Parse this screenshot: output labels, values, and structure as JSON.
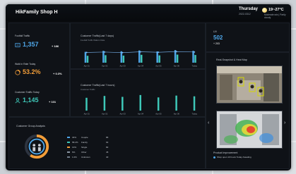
{
  "header": {
    "title": "HikFamily Shop H",
    "day": "Thursday",
    "date": "2022-0312",
    "temperature": "19~27°C",
    "weather": "Moderate rain | Partly cloudy"
  },
  "kpis": [
    {
      "label": "Footfall Traffic",
      "value": "1,357",
      "delta": "+ 186",
      "color": "#4ea6e8"
    },
    {
      "label": "Walk In Rate Today",
      "value": "53.2%",
      "delta": "+ 0.3%",
      "color": "#f29d38"
    },
    {
      "label": "Customer Traffic Today",
      "value": "1,145",
      "delta": "+ 101",
      "color": "#3ec7b8"
    }
  ],
  "traffic7days": {
    "title": "Customer Traffic(Last 7 days)",
    "legend": "Footfall Traffic  Walk-In Rate",
    "chart_data": {
      "type": "bar",
      "categories": [
        "Apr 01",
        "Apr 02",
        "Apr 03",
        "Apr 04",
        "Apr 05",
        "Apr 06",
        "Today"
      ],
      "series": [
        {
          "name": "Footfall Traffic",
          "values": [
            55,
            60,
            58,
            62,
            57,
            64,
            60
          ]
        },
        {
          "name": "Walk-In Rate",
          "values": [
            35,
            38,
            36,
            40,
            37,
            41,
            39
          ]
        }
      ],
      "line": [
        52,
        54,
        51,
        55,
        53,
        56,
        54
      ],
      "ylim": [
        0,
        100
      ],
      "colors": [
        "#4ea6e8",
        "#3ec7b8"
      ]
    }
  },
  "traffic7hours": {
    "title": "Customer Traffic(Last 7 hours)",
    "legend": "Customer Traffic",
    "chart_data": {
      "type": "bar",
      "categories": [
        "Apr 01",
        "Apr 02",
        "Apr 03",
        "Apr 04",
        "Apr 05",
        "Apr 06",
        "Today"
      ],
      "series": [
        {
          "name": "Customer Traffic",
          "values": [
            70,
            80,
            75,
            85,
            72,
            82,
            78
          ]
        }
      ],
      "ylim": [
        0,
        100
      ],
      "colors": [
        "#3ec7b8"
      ]
    }
  },
  "uv": {
    "label": "UV",
    "value": "502",
    "delta": "+ 203"
  },
  "heatmap": {
    "title": "Real-Snapshot & Heat Map"
  },
  "group": {
    "title": "Customer Group Analysis",
    "rows": [
      {
        "pct": "34%",
        "label": "Couple",
        "count": "86"
      },
      {
        "pct": "58.2%",
        "label": "Family",
        "count": "64"
      },
      {
        "pct": "13%",
        "label": "Single",
        "count": "82"
      },
      {
        "pct": "6%",
        "label": "Other",
        "count": "45"
      },
      {
        "pct": "1.0%",
        "label": "Unknown",
        "count": "40"
      }
    ]
  },
  "notes": {
    "title": "Product Improvement",
    "text": "Shop open 10 hours Today /Heading"
  }
}
